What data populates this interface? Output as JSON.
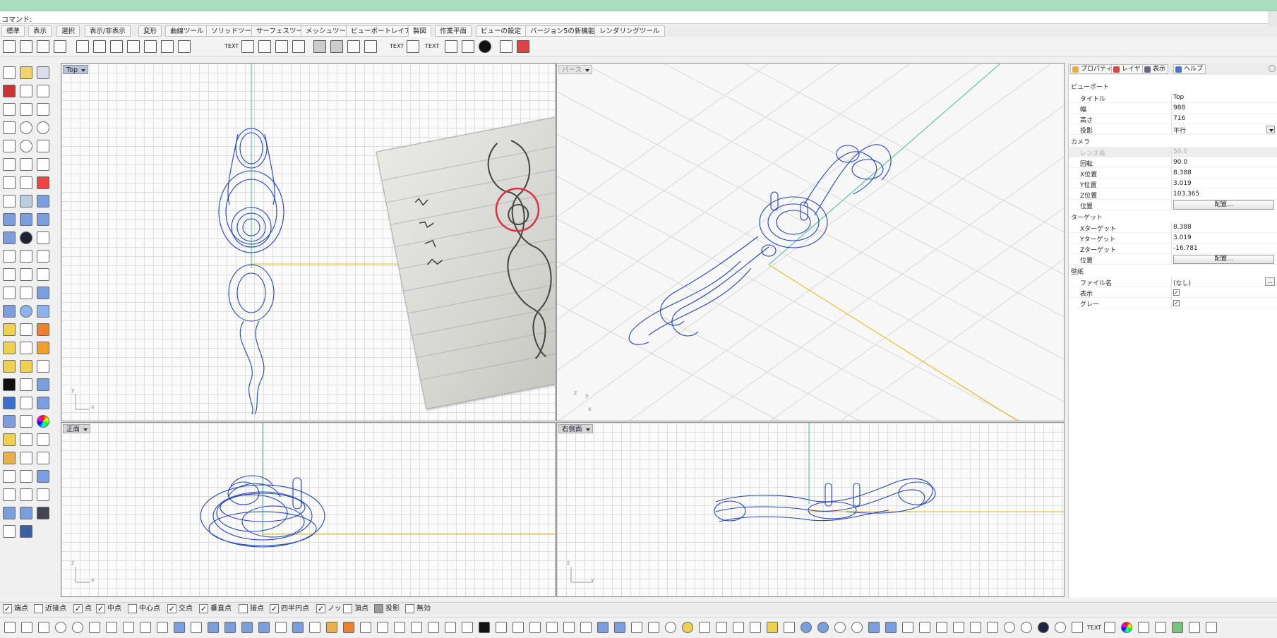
{
  "command": {
    "label": "コマンド:"
  },
  "tabs": [
    "標準",
    "表示",
    "選択",
    "表示/非表示",
    "変形",
    "曲線ツール",
    "ソリッドツール",
    "サーフェスツール",
    "メッシュツール",
    "ビューポートレイアウト",
    "製図",
    "作業平面",
    "ビューの設定",
    "バージョン5の新機能",
    "レンダリングツール"
  ],
  "active_tab": "製図",
  "viewports": {
    "top": {
      "label": "Top",
      "axis_v": "y",
      "axis_h": "x"
    },
    "perspective": {
      "label": "パース",
      "axis_v": "y",
      "axis_h": "x",
      "axis_z": "z"
    },
    "front": {
      "label": "正面",
      "axis_v": "z",
      "axis_h": "x"
    },
    "right": {
      "label": "右側面",
      "axis_v": "z",
      "axis_h": "y"
    }
  },
  "panel": {
    "tabs": [
      "プロパティ",
      "レイヤ",
      "表示",
      "ヘルプ"
    ],
    "sections": {
      "viewport": "ビューポート",
      "camera": "カメラ",
      "target": "ターゲット",
      "wallpaper": "壁紙"
    },
    "viewport_rows": [
      {
        "key": "タイトル",
        "value": "Top"
      },
      {
        "key": "幅",
        "value": "988"
      },
      {
        "key": "高さ",
        "value": "716"
      },
      {
        "key": "投影",
        "value": "平行"
      }
    ],
    "camera_rows": [
      {
        "key": "レンズ長",
        "value": "50.0"
      },
      {
        "key": "回転",
        "value": "90.0"
      },
      {
        "key": "X位置",
        "value": "8.388"
      },
      {
        "key": "Y位置",
        "value": "3.019"
      },
      {
        "key": "Z位置",
        "value": "103.365"
      },
      {
        "key": "位置",
        "value": "配置..."
      }
    ],
    "target_rows": [
      {
        "key": "Xターゲット",
        "value": "8.388"
      },
      {
        "key": "Yターゲット",
        "value": "3.019"
      },
      {
        "key": "Zターゲット",
        "value": "-16.781"
      },
      {
        "key": "位置",
        "value": "配置..."
      }
    ],
    "wallpaper_rows": [
      {
        "key": "ファイル名",
        "value": "(なし)"
      },
      {
        "key": "表示",
        "value": "✓"
      },
      {
        "key": "グレー",
        "value": "✓"
      }
    ],
    "dots": "..."
  },
  "osnaps": [
    {
      "label": "端点",
      "checked": true
    },
    {
      "label": "近接点",
      "checked": false
    },
    {
      "label": "点",
      "checked": true
    },
    {
      "label": "中点",
      "checked": true
    },
    {
      "label": "中心点",
      "checked": false
    },
    {
      "label": "交点",
      "checked": true
    },
    {
      "label": "垂直点",
      "checked": true
    },
    {
      "label": "接点",
      "checked": false
    },
    {
      "label": "四半円点",
      "checked": true
    },
    {
      "label": "ノット",
      "checked": true
    },
    {
      "label": "頂点",
      "checked": false
    },
    {
      "label": "投影",
      "checked": false,
      "grey": true
    },
    {
      "label": "無効",
      "checked": false
    }
  ],
  "toolbar_text_labels": {
    "text1": "TEXT",
    "text2": "TEXT",
    "text3": "TEXT",
    "bottom_text": "TEXT"
  },
  "colors": {
    "accent": "#a9dfc0",
    "wire": "#2244bb",
    "axis_y": "#3fbf8f",
    "axis_x": "#e8b400"
  }
}
